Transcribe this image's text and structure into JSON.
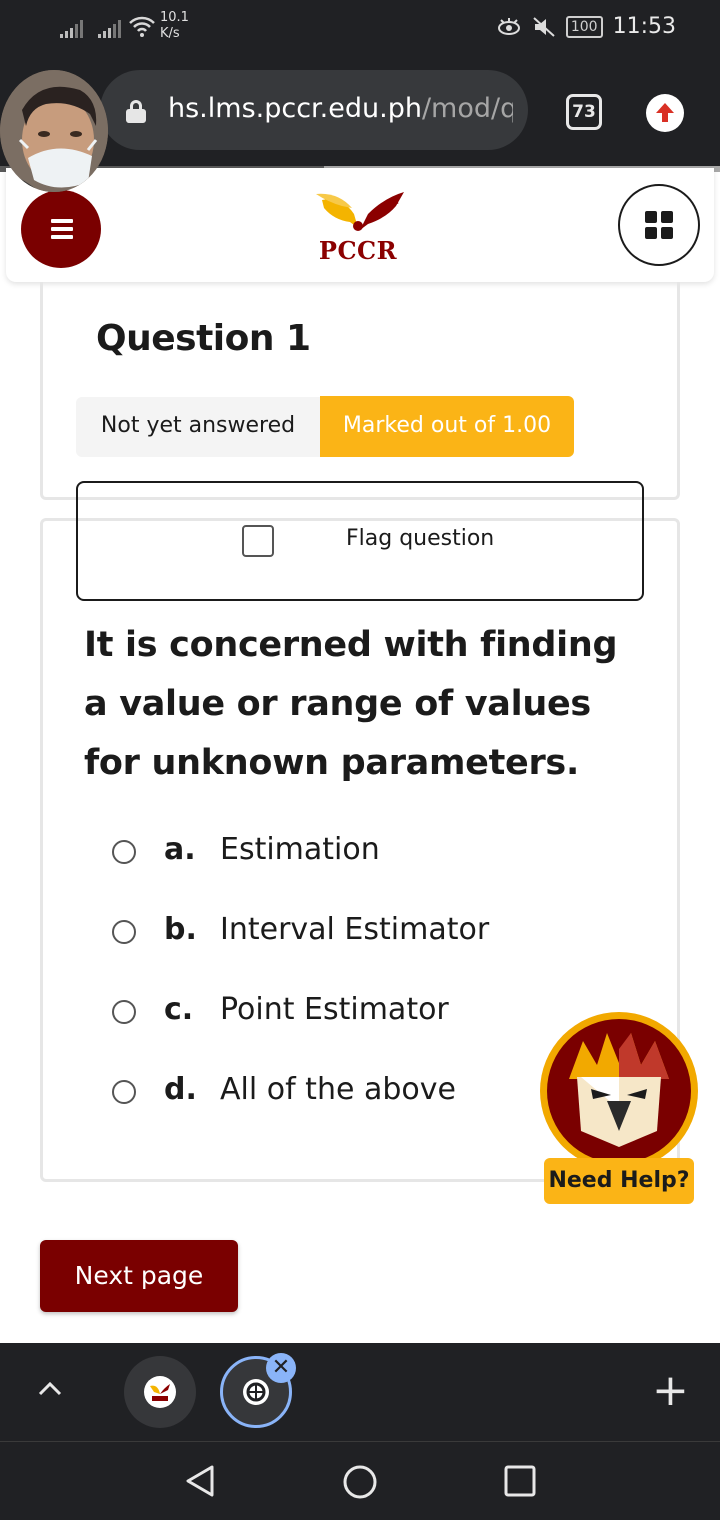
{
  "status_bar": {
    "network_speed_value": "10.1",
    "network_speed_unit": "K/s",
    "battery": "100",
    "time": "11:53",
    "icons": [
      "signal-icon",
      "signal-icon",
      "wifi-icon",
      "eye-comfort-icon",
      "mute-icon",
      "battery-icon"
    ]
  },
  "browser": {
    "url_host": "hs.lms.pccr.edu.ph",
    "url_path": "/mod/quiz",
    "tab_count": "73",
    "load_progress": 0.45
  },
  "site_header": {
    "logo_text": "PCCR",
    "brand_color": "#7a0000",
    "accent_color": "#fbb416"
  },
  "question": {
    "title": "Question 1",
    "status": "Not yet answered",
    "marks": "Marked out of 1.00",
    "flag_label": "Flag question",
    "text": "It is concerned with finding a value or range of values for unknown parameters.",
    "answers": [
      {
        "letter": "a.",
        "text": "Estimation"
      },
      {
        "letter": "b.",
        "text": "Interval Estimator"
      },
      {
        "letter": "c.",
        "text": "Point Estimator"
      },
      {
        "letter": "d.",
        "text": "All of the above"
      }
    ]
  },
  "help": {
    "label": "Need Help?"
  },
  "navigation": {
    "next_label": "Next page"
  },
  "tab_strip": {
    "close_glyph": "✕",
    "new_tab_glyph": "+"
  }
}
